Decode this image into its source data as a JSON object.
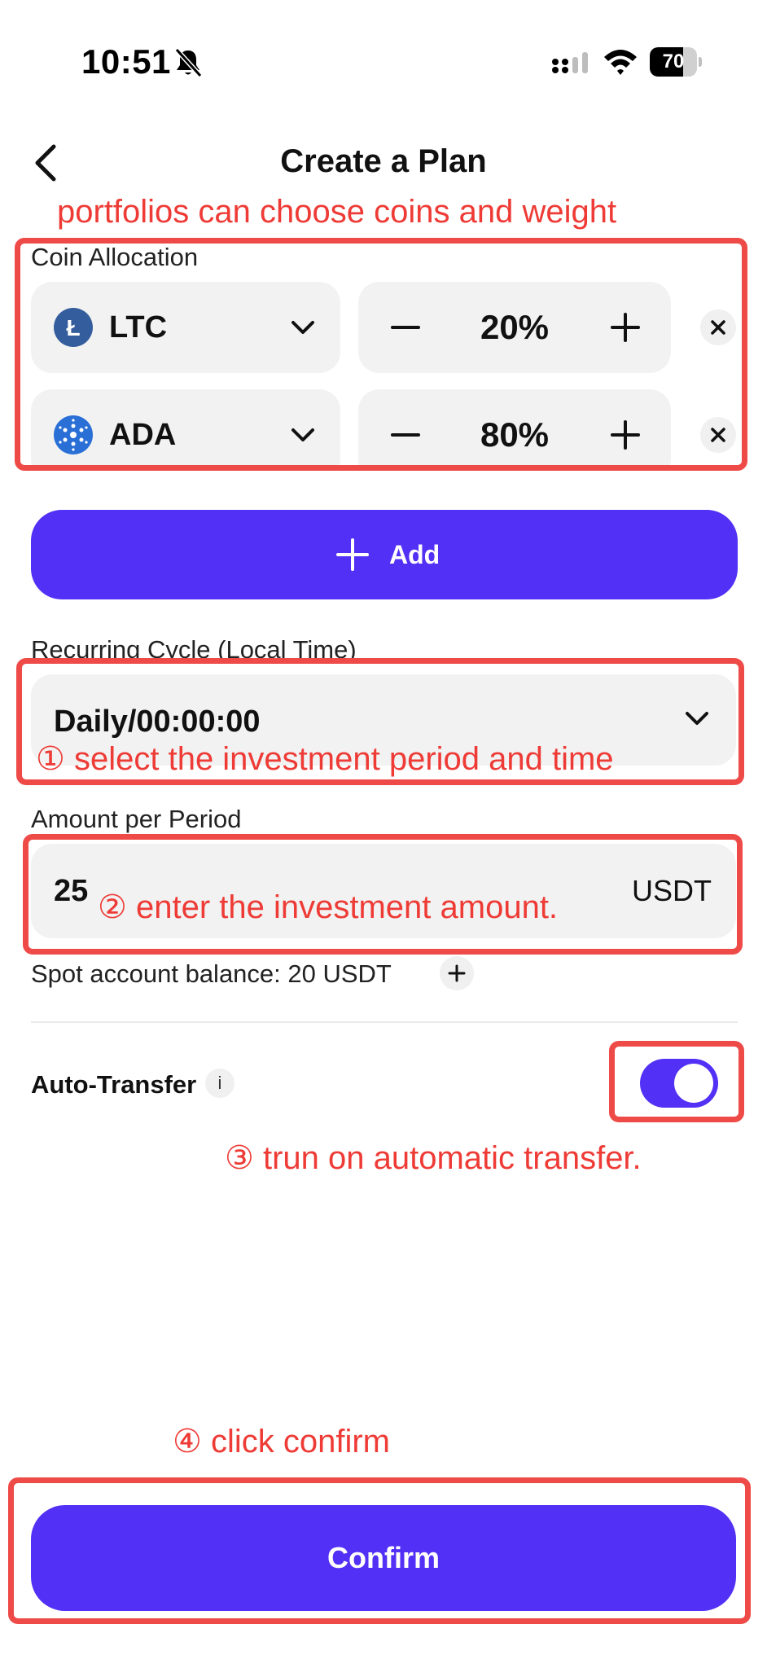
{
  "status_bar": {
    "time": "10:51",
    "battery_level": 70,
    "battery_label": "70"
  },
  "header": {
    "title": "Create a Plan"
  },
  "annotations": {
    "portfolio_note": "portfolios can choose coins and weight",
    "step1": "① select the investment period and time",
    "step2": "② enter the investment amount.",
    "step3": "③ trun on automatic transfer.",
    "step4": "④ click confirm"
  },
  "coin_allocation": {
    "label": "Coin Allocation",
    "rows": [
      {
        "coin": "LTC",
        "weight": "20%",
        "logo_color": "#345d9d",
        "logo_icon": "litecoin-logo-icon"
      },
      {
        "coin": "ADA",
        "weight": "80%",
        "logo_color": "#2a6fd6",
        "logo_icon": "cardano-logo-icon"
      }
    ]
  },
  "add_button": {
    "label": "Add"
  },
  "recurring_cycle": {
    "label": "Recurring Cycle (Local Time)",
    "value": "Daily/00:00:00"
  },
  "amount": {
    "label": "Amount per Period",
    "value": "25",
    "unit": "USDT"
  },
  "balance": {
    "text": "Spot account balance: 20 USDT"
  },
  "auto_transfer": {
    "label": "Auto-Transfer",
    "info": "i",
    "enabled": true
  },
  "confirm_button": {
    "label": "Confirm"
  },
  "colors": {
    "accent": "#5230f5",
    "annotation": "#ee3b36",
    "field_bg": "#f2f2f2"
  }
}
